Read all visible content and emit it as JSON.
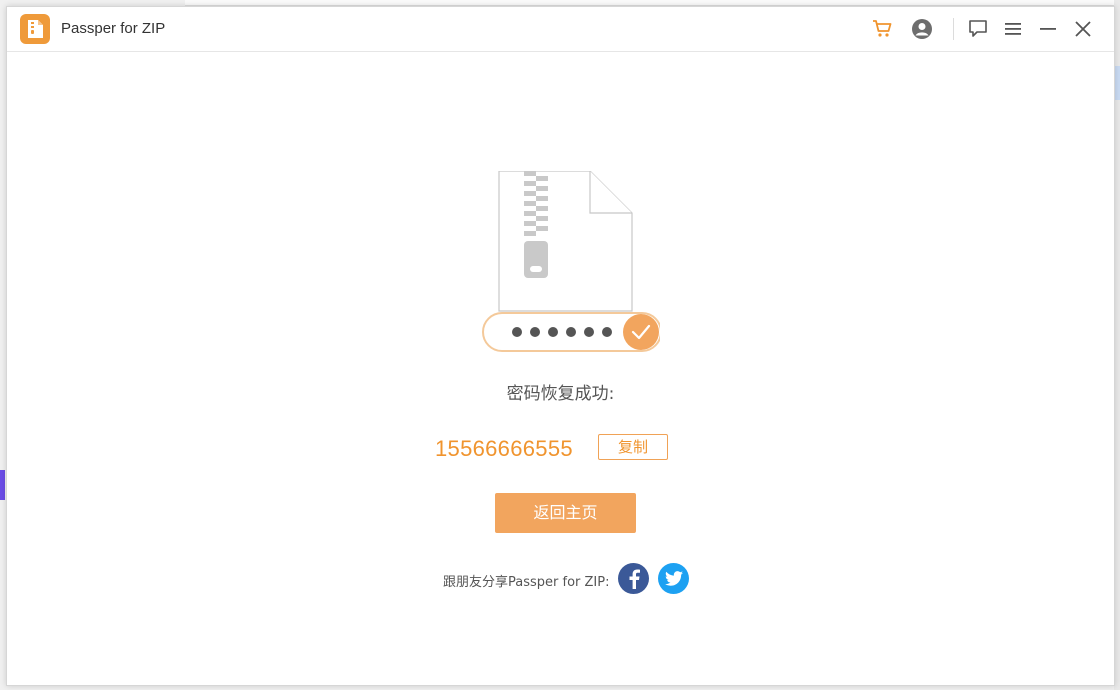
{
  "window": {
    "title": "Passper for ZIP"
  },
  "titlebar": {
    "icons": [
      "cart-icon",
      "account-icon",
      "feedback-icon",
      "menu-icon",
      "minimize-icon",
      "close-icon"
    ]
  },
  "result": {
    "success_label": "密码恢复成功:",
    "password": "15566666555",
    "copy_label": "复制",
    "masked_dots": "●●●●●●"
  },
  "actions": {
    "home_label": "返回主页"
  },
  "share": {
    "text": "跟朋友分享Passper for ZIP:",
    "networks": [
      "facebook-icon",
      "twitter-icon"
    ]
  },
  "colors": {
    "accent": "#f0942e",
    "button": "#f2a55e",
    "facebook": "#3b5998",
    "twitter": "#1da1f2"
  }
}
